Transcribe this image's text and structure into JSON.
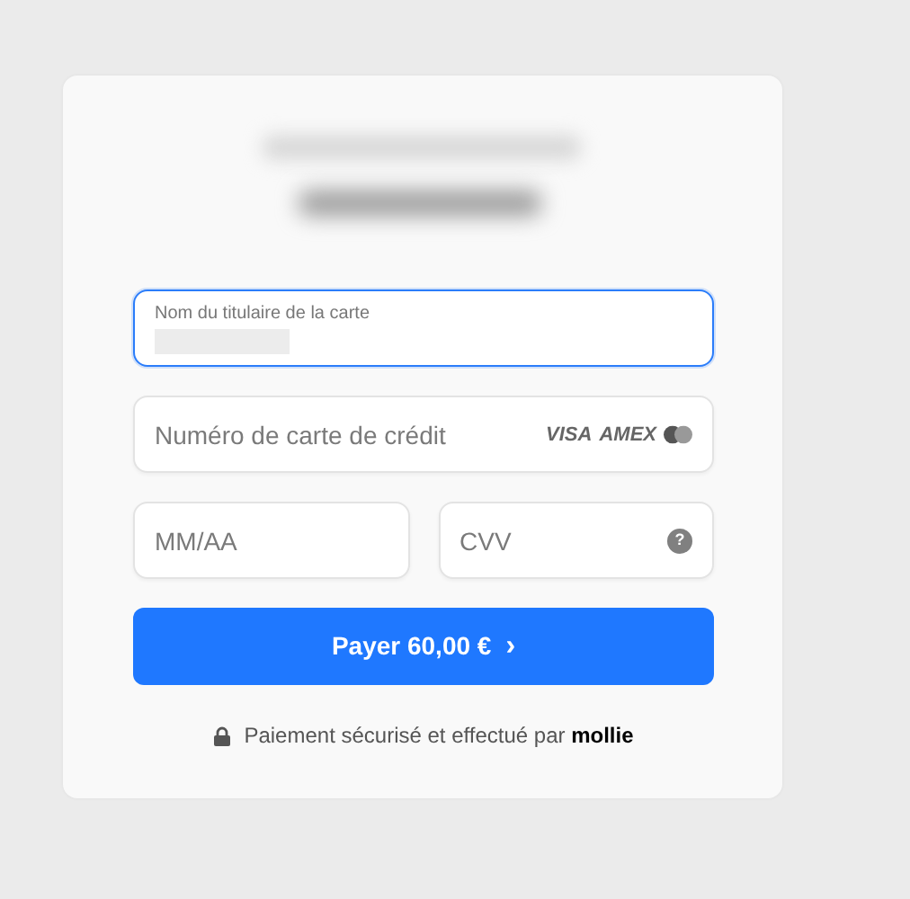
{
  "fields": [
    {
      "kind": "floating",
      "label": "Nom du titulaire de la carte",
      "focused": true,
      "value_blurred": true
    },
    {
      "kind": "card-number",
      "placeholder": "Numéro de carte de crédit",
      "focused": false,
      "brands": [
        "VISA",
        "AMEX"
      ]
    },
    {
      "kind": "expiry",
      "placeholder": "MM/AA",
      "focused": false
    },
    {
      "kind": "cvv",
      "placeholder": "CVV",
      "focused": false,
      "help": "?"
    }
  ],
  "pay_button": {
    "label": "Payer 60,00 €",
    "chevron": "›"
  },
  "footer": {
    "text": "Paiement sécurisé et effectué par",
    "brand": "mollie"
  }
}
